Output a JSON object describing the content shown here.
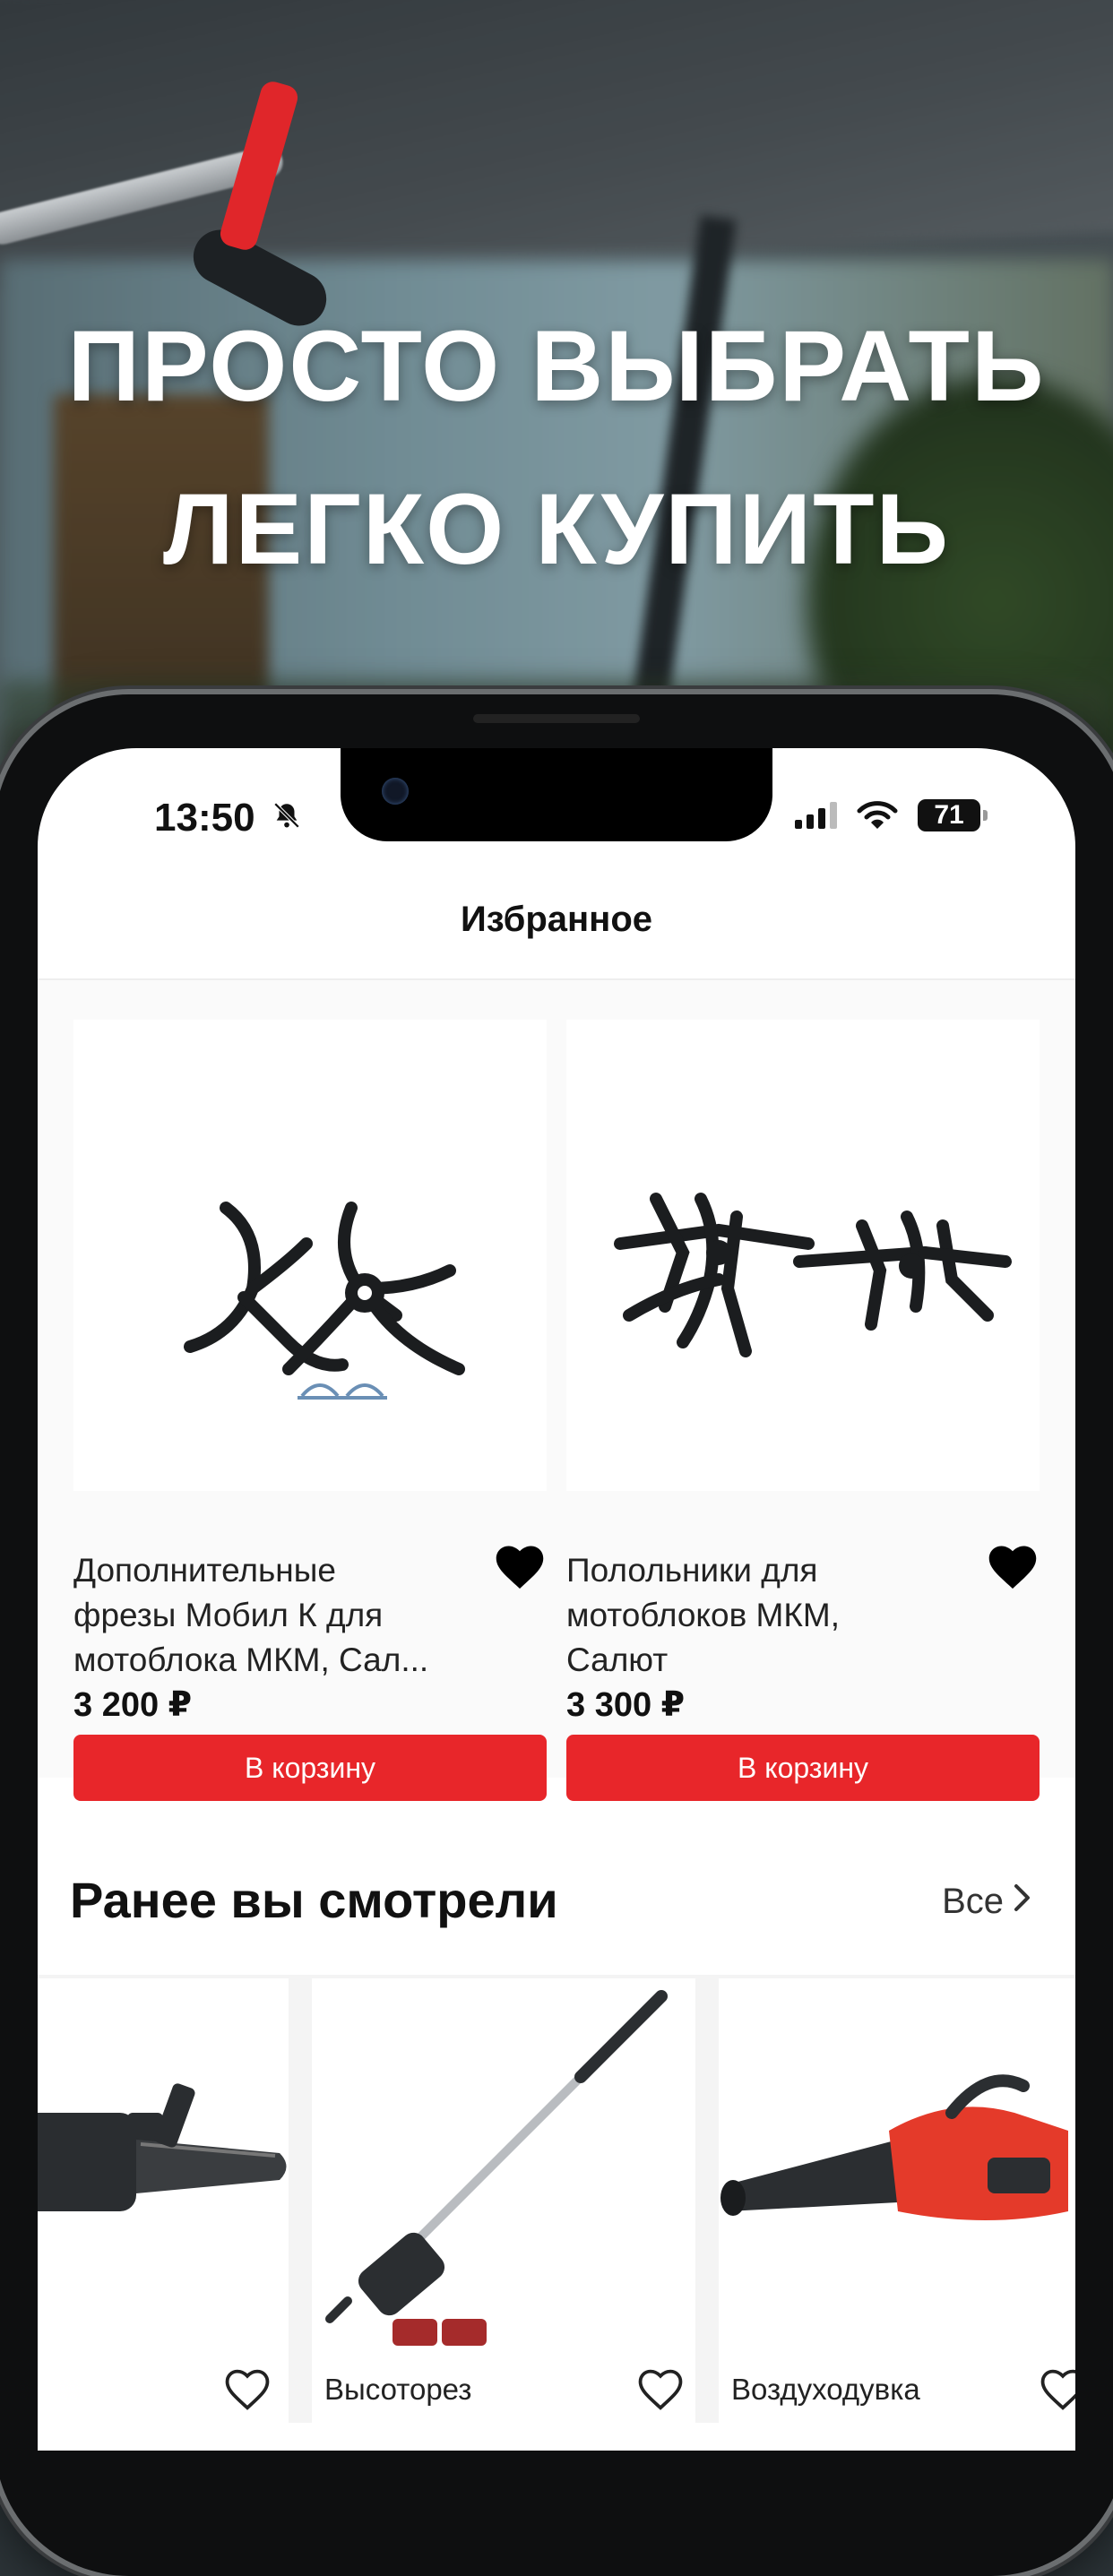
{
  "promo": {
    "line1": "ПРОСТО ВЫБРАТЬ",
    "line2": "ЛЕГКО КУПИТЬ"
  },
  "status_bar": {
    "time": "13:50",
    "bell_icon": "bell-slash-icon",
    "battery": "71"
  },
  "nav": {
    "title": "Избранное"
  },
  "favorites": [
    {
      "title_lines": [
        "Дополнительные",
        "фрезы Мобил К для",
        "мотоблока МКМ, Сал..."
      ],
      "price": "3 200 ₽",
      "button": "В корзину",
      "favorited": true
    },
    {
      "title_lines": [
        "Полольники для",
        "мотоблоков МКМ,",
        "Салют"
      ],
      "price": "3 300 ₽",
      "button": "В корзину",
      "favorited": true
    }
  ],
  "recent": {
    "heading": "Ранее вы смотрели",
    "see_all": "Все",
    "items": [
      {
        "title": "",
        "favorited": false
      },
      {
        "title": "Высоторез",
        "favorited": false
      },
      {
        "title": "Воздуходувка",
        "favorited": false
      }
    ]
  },
  "colors": {
    "accent": "#e8262a",
    "text": "#111111"
  }
}
